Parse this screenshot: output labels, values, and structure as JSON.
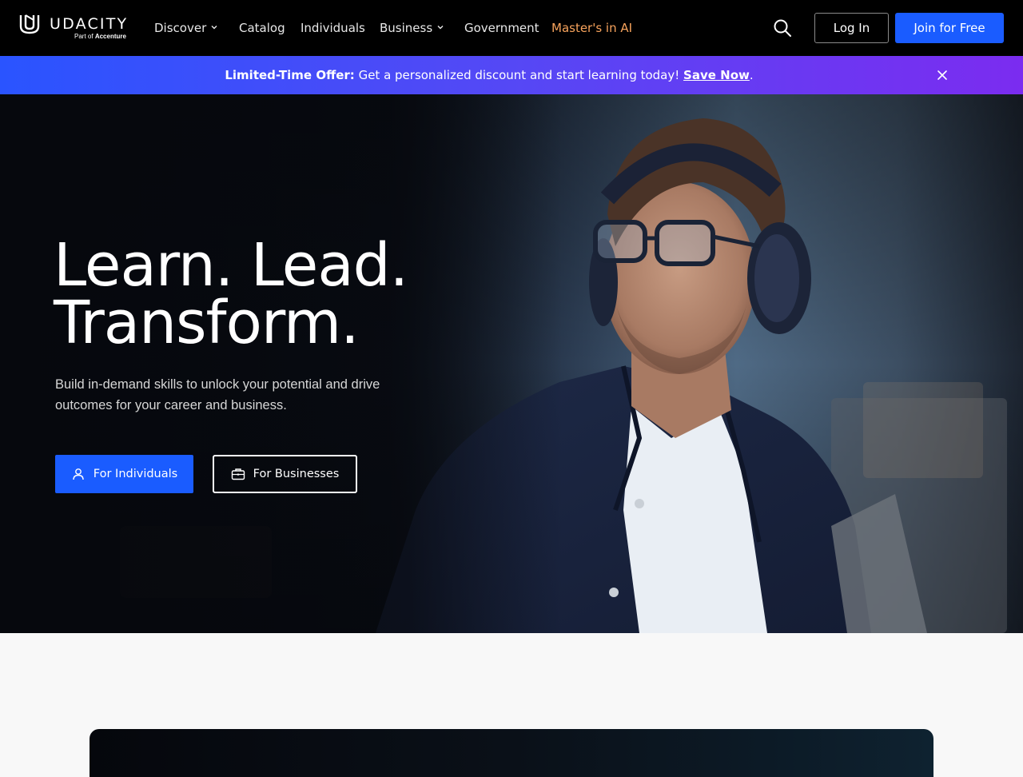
{
  "brand": {
    "name": "UDACITY",
    "tagline_prefix": "Part of",
    "tagline_brand": "Accenture"
  },
  "nav": {
    "items": [
      {
        "label": "Discover",
        "has_dropdown": true
      },
      {
        "label": "Catalog",
        "has_dropdown": false
      },
      {
        "label": "Individuals",
        "has_dropdown": false
      },
      {
        "label": "Business",
        "has_dropdown": true
      },
      {
        "label": "Government",
        "has_dropdown": false
      },
      {
        "label": "Master's in AI",
        "has_dropdown": false,
        "highlight": true
      }
    ],
    "search_icon": "search-icon",
    "login_label": "Log In",
    "join_label": "Join for Free"
  },
  "promo": {
    "bold_label": "Limited-Time Offer:",
    "message": " Get a personalized discount and start learning today! ",
    "link_label": "Save Now",
    "suffix": ".",
    "close_icon": "close-icon"
  },
  "hero": {
    "title": "Learn. Lead.\nTransform.",
    "subtitle": "Build in-demand skills to unlock your potential and drive outcomes for your career and business.",
    "cta_individuals": "For Individuals",
    "cta_individuals_icon": "user-icon",
    "cta_businesses": "For Businesses",
    "cta_businesses_icon": "briefcase-icon"
  },
  "colors": {
    "nav_bg": "#000000",
    "primary_blue": "#1a5cff",
    "highlight_orange": "#f7a35c",
    "promo_gradient_start": "#2a54ff",
    "promo_gradient_end": "#7b2cf0",
    "page_bg": "#f8f8f8"
  }
}
